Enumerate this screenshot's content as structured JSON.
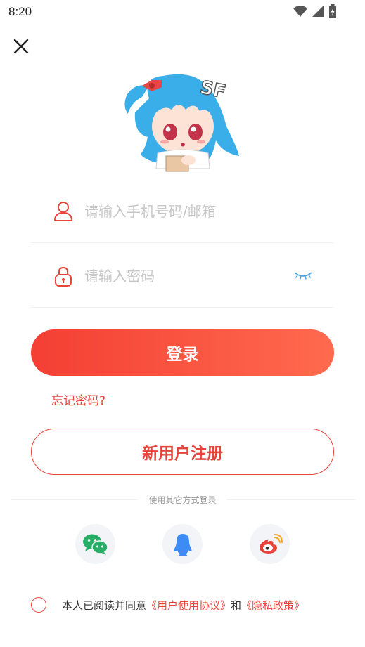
{
  "status_bar": {
    "time": "8:20",
    "icons": [
      "wifi-icon",
      "signal-icon",
      "battery-charging-icon"
    ]
  },
  "header": {
    "close_icon": "close-icon"
  },
  "mascot": {
    "logo_text": "SF"
  },
  "form": {
    "phone_placeholder": "请输入手机号码/邮箱",
    "phone_value": "",
    "password_placeholder": "请输入密码",
    "password_value": "",
    "login_label": "登录",
    "forgot_label": "忘记密码?",
    "register_label": "新用户注册"
  },
  "other_login": {
    "label": "使用其它方式登录",
    "providers": [
      {
        "name": "wechat",
        "icon": "wechat-icon",
        "color": "#2aae67"
      },
      {
        "name": "qq",
        "icon": "qq-icon",
        "color": "#3d8cf5"
      },
      {
        "name": "weibo",
        "icon": "weibo-icon",
        "color": "#e8443b"
      }
    ]
  },
  "agreement": {
    "prefix": "本人已阅读并同意",
    "user_agreement": "《用户使用协议》",
    "conjunction": "和",
    "privacy_policy": "《隐私政策》"
  },
  "colors": {
    "accent": "#e8443b",
    "button_gradient_start": "#f43f34",
    "button_gradient_end": "#ff6a4e",
    "placeholder": "#c7c7c7",
    "eye_icon": "#4aa3df"
  }
}
